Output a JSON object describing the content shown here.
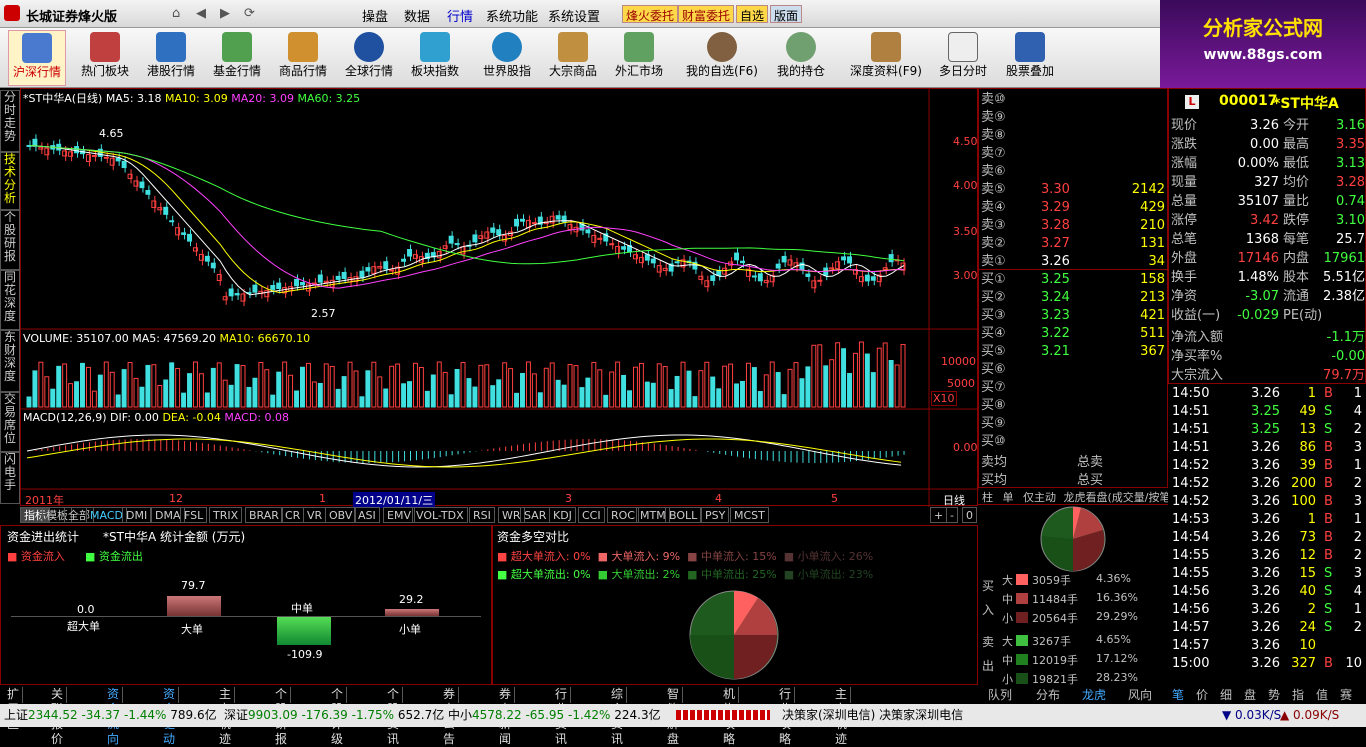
{
  "app": {
    "title": "长城证券烽火版"
  },
  "menus": [
    "操盘",
    "数据",
    "行情",
    "系统功能",
    "系统设置"
  ],
  "quick": [
    "烽火委托",
    "财富委托",
    "自选",
    "版面"
  ],
  "toolbar": [
    "沪深行情",
    "热门板块",
    "港股行情",
    "基金行情",
    "商品行情",
    "全球行情",
    "板块指数",
    "世界股指",
    "大宗商品",
    "外汇市场",
    "我的自选(F6)",
    "我的持仓",
    "深度资料(F9)",
    "多日分时",
    "股票叠加"
  ],
  "logo": {
    "name": "分析家公式网",
    "url": "www.88gs.com"
  },
  "left_tabs": [
    "分时走势",
    "技术分析",
    "个股研报",
    "同花深度",
    "东财深度",
    "交易席位",
    "闪电手"
  ],
  "chart": {
    "title": "*ST中华A(日线)",
    "ma5": "MA5: 3.18",
    "ma10": "MA10: 3.09",
    "ma20": "MA20: 3.09",
    "ma60": "MA60: 3.25",
    "hi_label": "4.65",
    "lo_label": "2.57",
    "y_ticks": [
      "4.50",
      "4.00",
      "3.50",
      "3.00"
    ],
    "vol_title": "VOLUME: 35107.00",
    "vol_ma5": "MA5: 47569.20",
    "vol_ma10": "MA10: 66670.10",
    "vol_ticks": [
      "10000",
      "5000"
    ],
    "vol_unit": "X10",
    "macd_title": "MACD(12,26,9)",
    "dif": "DIF: 0.00",
    "dea": "DEA: -0.04",
    "macd": "MACD: 0.08",
    "macd_tick": "0.00",
    "x_labels": [
      "2011年",
      "12",
      "1",
      "2012/01/11/三",
      "3",
      "4",
      "5"
    ],
    "period": "日线"
  },
  "ind_tabs": [
    "指标",
    "模板",
    "全部",
    "MACD",
    "DMI",
    "DMA",
    "FSL",
    "TRIX",
    "BRAR",
    "CR",
    "VR",
    "OBV",
    "ASI",
    "EMV",
    "VOL-TDX",
    "RSI",
    "WR",
    "SAR",
    "KDJ",
    "CCI",
    "ROC",
    "MTM",
    "BOLL",
    "PSY",
    "MCST"
  ],
  "zoom": [
    "+",
    "-",
    "0"
  ],
  "flow": {
    "title": "资金进出统计",
    "sub": "*ST中华A  统计金额 (万元)",
    "leg_in": "资金流入",
    "leg_out": "资金流出",
    "bars": [
      {
        "label": "超大单",
        "value": "0.0"
      },
      {
        "label": "大单",
        "value": "79.7"
      },
      {
        "label": "中单",
        "value": "-109.9"
      },
      {
        "label": "小单",
        "value": "29.2"
      }
    ]
  },
  "compare": {
    "title": "资金多空对比",
    "in": [
      {
        "label": "超大单流入:",
        "pct": "0%"
      },
      {
        "label": "大单流入:",
        "pct": "9%"
      },
      {
        "label": "中单流入:",
        "pct": "15%"
      },
      {
        "label": "小单流入:",
        "pct": "26%"
      }
    ],
    "out": [
      {
        "label": "超大单流出:",
        "pct": "0%"
      },
      {
        "label": "大单流出:",
        "pct": "2%"
      },
      {
        "label": "中单流出:",
        "pct": "25%"
      },
      {
        "label": "小单流出:",
        "pct": "23%"
      }
    ]
  },
  "orderbook": {
    "sell": [
      {
        "n": "卖⑩"
      },
      {
        "n": "卖⑨"
      },
      {
        "n": "卖⑧"
      },
      {
        "n": "卖⑦"
      },
      {
        "n": "卖⑥"
      },
      {
        "n": "卖⑤",
        "p": "3.30",
        "v": "2142"
      },
      {
        "n": "卖④",
        "p": "3.29",
        "v": "429"
      },
      {
        "n": "卖③",
        "p": "3.28",
        "v": "210"
      },
      {
        "n": "卖②",
        "p": "3.27",
        "v": "131"
      },
      {
        "n": "卖①",
        "p": "3.26",
        "v": "34"
      }
    ],
    "buy": [
      {
        "n": "买①",
        "p": "3.25",
        "v": "158"
      },
      {
        "n": "买②",
        "p": "3.24",
        "v": "213"
      },
      {
        "n": "买③",
        "p": "3.23",
        "v": "421"
      },
      {
        "n": "买④",
        "p": "3.22",
        "v": "511"
      },
      {
        "n": "买⑤",
        "p": "3.21",
        "v": "367"
      },
      {
        "n": "买⑥"
      },
      {
        "n": "买⑦"
      },
      {
        "n": "买⑧"
      },
      {
        "n": "买⑨"
      },
      {
        "n": "买⑩"
      }
    ],
    "avg_sell": "卖均",
    "avg_buy": "买均",
    "total_sell": "总卖",
    "total_buy": "总买"
  },
  "ob_tabs": [
    "柱",
    "单",
    "仅主动",
    "龙虎看盘(成交量/按笔)"
  ],
  "bigorder": {
    "buy_label": "买入",
    "sell_label": "卖出",
    "rows": [
      {
        "s": "大",
        "v": "3059手",
        "p": "4.36%"
      },
      {
        "s": "中",
        "v": "11484手",
        "p": "16.36%"
      },
      {
        "s": "小",
        "v": "20564手",
        "p": "29.29%"
      },
      {
        "s": "大",
        "v": "3267手",
        "p": "4.65%"
      },
      {
        "s": "中",
        "v": "12019手",
        "p": "17.12%"
      },
      {
        "s": "小",
        "v": "19821手",
        "p": "28.23%"
      }
    ]
  },
  "mid_tabs": [
    "队列",
    "分布",
    "龙虎",
    "风向"
  ],
  "quote": {
    "code": "000017",
    "name": "*ST中华A",
    "badge": "L",
    "rows": [
      [
        "现价",
        "3.26",
        "今开",
        "3.16"
      ],
      [
        "涨跌",
        "0.00",
        "最高",
        "3.35"
      ],
      [
        "涨幅",
        "0.00%",
        "最低",
        "3.13"
      ],
      [
        "现量",
        "327",
        "均价",
        "3.28"
      ],
      [
        "总量",
        "35107",
        "量比",
        "0.74"
      ],
      [
        "涨停",
        "3.42",
        "跌停",
        "3.10"
      ],
      [
        "总笔",
        "1368",
        "每笔",
        "25.7"
      ],
      [
        "外盘",
        "17146",
        "内盘",
        "17961"
      ],
      [
        "换手",
        "1.48%",
        "股本",
        "5.51亿"
      ],
      [
        "净资",
        "-3.07",
        "流通",
        "2.38亿"
      ],
      [
        "收益(一)",
        "-0.029",
        "PE(动)",
        ""
      ]
    ],
    "extra": [
      [
        "净流入额",
        "-1.1万"
      ],
      [
        "净买率%",
        "-0.00"
      ],
      [
        "大宗流入",
        "79.7万"
      ]
    ]
  },
  "ticks": [
    [
      "14:50",
      "3.26",
      "1",
      "B",
      "1"
    ],
    [
      "14:51",
      "3.25",
      "49",
      "S",
      "4"
    ],
    [
      "14:51",
      "3.25",
      "13",
      "S",
      "2"
    ],
    [
      "14:51",
      "3.26",
      "86",
      "B",
      "3"
    ],
    [
      "14:52",
      "3.26",
      "39",
      "B",
      "1"
    ],
    [
      "14:52",
      "3.26",
      "200",
      "B",
      "2"
    ],
    [
      "14:52",
      "3.26",
      "100",
      "B",
      "3"
    ],
    [
      "14:53",
      "3.26",
      "1",
      "B",
      "1"
    ],
    [
      "14:54",
      "3.26",
      "73",
      "B",
      "2"
    ],
    [
      "14:55",
      "3.26",
      "12",
      "B",
      "2"
    ],
    [
      "14:55",
      "3.26",
      "15",
      "S",
      "3"
    ],
    [
      "14:56",
      "3.26",
      "40",
      "S",
      "4"
    ],
    [
      "14:56",
      "3.26",
      "2",
      "S",
      "1"
    ],
    [
      "14:57",
      "3.26",
      "24",
      "S",
      "2"
    ],
    [
      "14:57",
      "3.26",
      "10",
      "",
      ""
    ],
    [
      "15:00",
      "3.26",
      "327",
      "B",
      "10"
    ]
  ],
  "right_tabs": [
    "笔",
    "价",
    "细",
    "盘",
    "势",
    "指",
    "值",
    "赛"
  ],
  "bottom_tabs": [
    "扩展区",
    "关联报价",
    "资金流向",
    "资金驱动",
    "主力轨迹",
    "个股研报",
    "个股评级",
    "个股资讯",
    "券商公告",
    "券商新闻",
    "行业资讯",
    "综合资讯",
    "智能解盘",
    "机构攻略",
    "行业攻略",
    "主力轨迹"
  ],
  "status": {
    "sh": "上证",
    "sh_v": "2344.52",
    "sh_c": "-34.37",
    "sh_p": "-1.44%",
    "sh_a": "789.6亿",
    "sz": "深证",
    "sz_v": "9903.09",
    "sz_c": "-176.39",
    "sz_p": "-1.75%",
    "sz_a": "652.7亿",
    "zx": "中小",
    "zx_v": "4578.22",
    "zx_c": "-65.95",
    "zx_p": "-1.42%",
    "zx_a": "224.3亿",
    "news": "决策家(深圳电信)  决策家深圳电信",
    "down": "0.03K/S",
    "up": "0.09K/S"
  }
}
